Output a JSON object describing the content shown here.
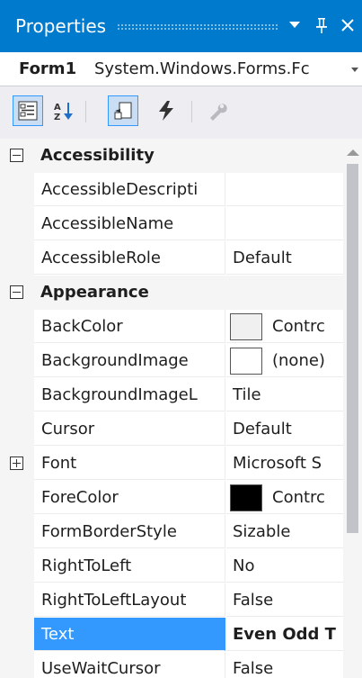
{
  "panel": {
    "title": "Properties",
    "dropdown_icon": "triangle-down-icon",
    "pin_icon": "pin-icon",
    "close_icon": "close-icon"
  },
  "object_selector": {
    "name": "Form1",
    "type": "System.Windows.Forms.Fc"
  },
  "toolbar": {
    "buttons": [
      {
        "icon": "categorized-icon",
        "active": true
      },
      {
        "icon": "alphabetical-icon",
        "active": false
      },
      {
        "icon": "properties-icon",
        "active": true
      },
      {
        "icon": "events-lightning-icon",
        "active": false
      },
      {
        "icon": "property-pages-wrench-icon",
        "active": false,
        "disabled": true
      }
    ]
  },
  "grid": {
    "rows": [
      {
        "kind": "category",
        "label": "Accessibility",
        "expanded": true
      },
      {
        "kind": "property",
        "name": "AccessibleDescripti",
        "value": ""
      },
      {
        "kind": "property",
        "name": "AccessibleName",
        "value": ""
      },
      {
        "kind": "property",
        "name": "AccessibleRole",
        "value": "Default"
      },
      {
        "kind": "category",
        "label": "Appearance",
        "expanded": true
      },
      {
        "kind": "property",
        "name": "BackColor",
        "value": "Contrc",
        "swatch": "#f0f0f0"
      },
      {
        "kind": "property",
        "name": "BackgroundImage",
        "value": "(none)",
        "swatch": "#ffffff"
      },
      {
        "kind": "property",
        "name": "BackgroundImageL",
        "value": "Tile"
      },
      {
        "kind": "property",
        "name": "Cursor",
        "value": "Default"
      },
      {
        "kind": "property",
        "name": "Font",
        "value": "Microsoft S",
        "expandable": true
      },
      {
        "kind": "property",
        "name": "ForeColor",
        "value": "Contrc",
        "swatch": "#000000"
      },
      {
        "kind": "property",
        "name": "FormBorderStyle",
        "value": "Sizable"
      },
      {
        "kind": "property",
        "name": "RightToLeft",
        "value": "No"
      },
      {
        "kind": "property",
        "name": "RightToLeftLayout",
        "value": "False"
      },
      {
        "kind": "property",
        "name": "Text",
        "value": "Even Odd T",
        "selected": true,
        "bold": true
      },
      {
        "kind": "property",
        "name": "UseWaitCursor",
        "value": "False"
      }
    ]
  },
  "colors": {
    "accent": "#007acc",
    "selection": "#3399ff"
  }
}
